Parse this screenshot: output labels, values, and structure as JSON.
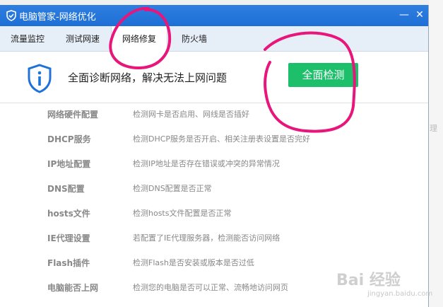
{
  "window": {
    "title": "电脑管家-网络优化",
    "min_glyph": "—",
    "close_glyph": "✕"
  },
  "tabs": [
    {
      "label": "流量监控",
      "active": false
    },
    {
      "label": "测试网速",
      "active": false
    },
    {
      "label": "网络修复",
      "active": true
    },
    {
      "label": "防火墙",
      "active": false
    }
  ],
  "header": {
    "description": "全面诊断网络，解决无法上网问题",
    "check_button": "全面检测"
  },
  "items": [
    {
      "name": "网络硬件配置",
      "desc": "检测网卡是否启用、网线是否插好"
    },
    {
      "name": "DHCP服务",
      "desc": "检测DHCP服务是否开启、相关注册表设置是否完好"
    },
    {
      "name": "IP地址配置",
      "desc": "检测IP地址是否存在错误或冲突的异常情况"
    },
    {
      "name": "DNS配置",
      "desc": "检测DNS配置是否正常"
    },
    {
      "name": "hosts文件",
      "desc": "检测hosts文件配置是否正常"
    },
    {
      "name": "IE代理设置",
      "desc": "若配置了IE代理服务器，检测能否访问网络"
    },
    {
      "name": "Flash插件",
      "desc": "检测Flash是否安装或版本是否过低"
    },
    {
      "name": "电脑能否上网",
      "desc": "检测您的电脑是否可以正常、流畅地访问网页"
    }
  ],
  "background": {
    "side_text": "理",
    "watermark": "Bai 经验",
    "watermark_sub": "jingyan.baidu.com"
  },
  "colors": {
    "titlebar": "#1e6fd6",
    "check_button": "#1dbf6b",
    "annotation": "#e8157a"
  },
  "icons": {
    "title_logo": "shield-logo-icon",
    "header": "shield-info-icon"
  }
}
